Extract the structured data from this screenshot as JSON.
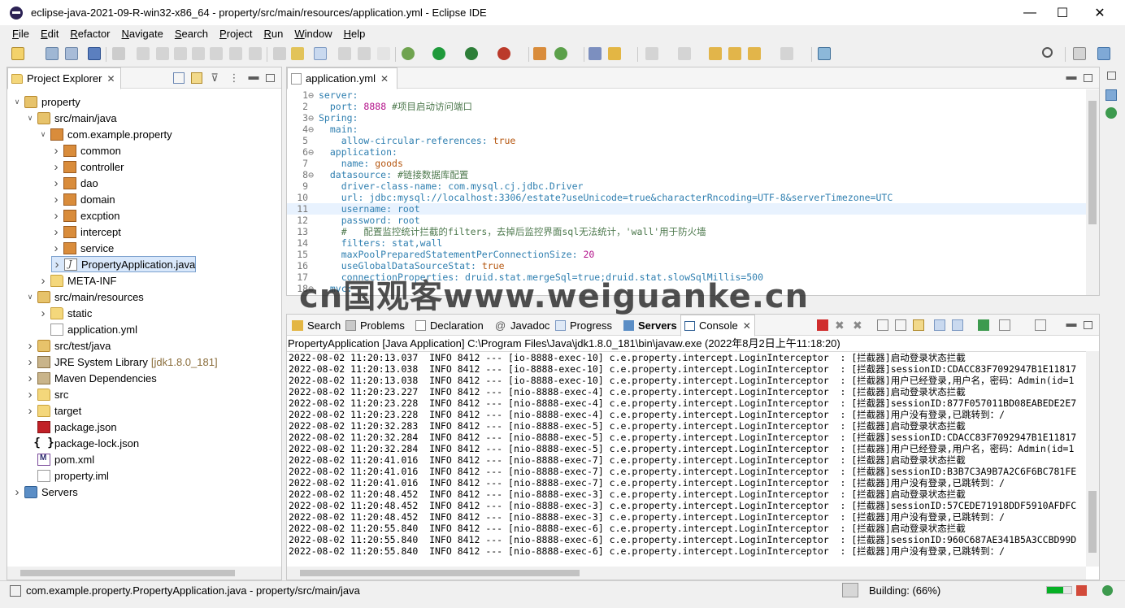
{
  "window": {
    "title": "eclipse-java-2021-09-R-win32-x86_64 - property/src/main/resources/application.yml - Eclipse IDE",
    "minimize": "—",
    "maximize": "☐",
    "close": "✕"
  },
  "menu": [
    "File",
    "Edit",
    "Refactor",
    "Navigate",
    "Search",
    "Project",
    "Run",
    "Window",
    "Help"
  ],
  "explorer": {
    "tab_label": "Project Explorer",
    "tree": [
      {
        "label": "property",
        "level": 0,
        "twisty": "v",
        "icon": "project-icon"
      },
      {
        "label": "src/main/java",
        "level": 1,
        "twisty": "v",
        "icon": "source-folder-icon"
      },
      {
        "label": "com.example.property",
        "level": 2,
        "twisty": "v",
        "icon": "package-icon"
      },
      {
        "label": "common",
        "level": 3,
        "twisty": ">",
        "icon": "package-icon"
      },
      {
        "label": "controller",
        "level": 3,
        "twisty": ">",
        "icon": "package-icon"
      },
      {
        "label": "dao",
        "level": 3,
        "twisty": ">",
        "icon": "package-icon"
      },
      {
        "label": "domain",
        "level": 3,
        "twisty": ">",
        "icon": "package-icon"
      },
      {
        "label": "excption",
        "level": 3,
        "twisty": ">",
        "icon": "package-icon"
      },
      {
        "label": "intercept",
        "level": 3,
        "twisty": ">",
        "icon": "package-icon"
      },
      {
        "label": "service",
        "level": 3,
        "twisty": ">",
        "icon": "package-icon"
      },
      {
        "label": "PropertyApplication.java",
        "level": 3,
        "twisty": ">",
        "icon": "java-file-icon",
        "selected": true
      },
      {
        "label": "META-INF",
        "level": 2,
        "twisty": ">",
        "icon": "folder-icon"
      },
      {
        "label": "src/main/resources",
        "level": 1,
        "twisty": "v",
        "icon": "source-folder-icon"
      },
      {
        "label": "static",
        "level": 2,
        "twisty": ">",
        "icon": "folder-icon"
      },
      {
        "label": "application.yml",
        "level": 2,
        "twisty": "",
        "icon": "yml-file-icon"
      },
      {
        "label": "src/test/java",
        "level": 1,
        "twisty": ">",
        "icon": "source-folder-icon"
      },
      {
        "label": "JRE System Library",
        "decor": "[jdk1.8.0_181]",
        "level": 1,
        "twisty": ">",
        "icon": "library-icon"
      },
      {
        "label": "Maven Dependencies",
        "level": 1,
        "twisty": ">",
        "icon": "library-icon"
      },
      {
        "label": "src",
        "level": 1,
        "twisty": ">",
        "icon": "folder-icon"
      },
      {
        "label": "target",
        "level": 1,
        "twisty": ">",
        "icon": "folder-icon"
      },
      {
        "label": "package.json",
        "level": 1,
        "twisty": "",
        "icon": "npm-icon"
      },
      {
        "label": "package-lock.json",
        "level": 1,
        "twisty": "",
        "icon": "json-icon"
      },
      {
        "label": "pom.xml",
        "level": 1,
        "twisty": "",
        "icon": "maven-xml-icon"
      },
      {
        "label": "property.iml",
        "level": 1,
        "twisty": "",
        "icon": "file-icon"
      },
      {
        "label": "Servers",
        "level": 0,
        "twisty": ">",
        "icon": "servers-folder-icon"
      }
    ]
  },
  "editor": {
    "tab_label": "application.yml",
    "lines": [
      {
        "n": "1",
        "fold": "⊖",
        "parts": [
          [
            "k",
            "server:"
          ]
        ]
      },
      {
        "n": "2",
        "fold": "",
        "parts": [
          [
            "p",
            "  "
          ],
          [
            "k",
            "port:"
          ],
          [
            "p",
            " "
          ],
          [
            "n",
            "8888"
          ],
          [
            "c",
            " #项目启动访问端口"
          ]
        ]
      },
      {
        "n": "3",
        "fold": "⊖",
        "parts": [
          [
            "k",
            "Spring:"
          ]
        ]
      },
      {
        "n": "4",
        "fold": "⊖",
        "parts": [
          [
            "p",
            "  "
          ],
          [
            "k",
            "main:"
          ]
        ]
      },
      {
        "n": "5",
        "fold": "",
        "parts": [
          [
            "p",
            "    "
          ],
          [
            "k",
            "allow-circular-references:"
          ],
          [
            "p",
            " "
          ],
          [
            "v",
            "true"
          ]
        ]
      },
      {
        "n": "6",
        "fold": "⊖",
        "parts": [
          [
            "p",
            "  "
          ],
          [
            "k",
            "application:"
          ]
        ]
      },
      {
        "n": "7",
        "fold": "",
        "parts": [
          [
            "p",
            "    "
          ],
          [
            "k",
            "name:"
          ],
          [
            "p",
            " "
          ],
          [
            "v",
            "goods"
          ]
        ]
      },
      {
        "n": "8",
        "fold": "⊖",
        "parts": [
          [
            "p",
            "  "
          ],
          [
            "k",
            "datasource:"
          ],
          [
            "c",
            " #链接数据库配置"
          ]
        ]
      },
      {
        "n": "9",
        "fold": "",
        "parts": [
          [
            "p",
            "    "
          ],
          [
            "k",
            "driver-class-name:"
          ],
          [
            "p",
            " "
          ],
          [
            "k",
            "com.mysql.cj.jdbc.Driver"
          ]
        ]
      },
      {
        "n": "10",
        "fold": "",
        "parts": [
          [
            "p",
            "    "
          ],
          [
            "k",
            "url:"
          ],
          [
            "p",
            " "
          ],
          [
            "k",
            "jdbc:mysql://localhost:3306/estate?useUnicode=true&characterRncoding=UTF-8&serverTimezone=UTC"
          ]
        ]
      },
      {
        "n": "11",
        "fold": "",
        "parts": [
          [
            "p",
            "    "
          ],
          [
            "k",
            "username:"
          ],
          [
            "p",
            " "
          ],
          [
            "k",
            "root"
          ]
        ]
      },
      {
        "n": "12",
        "fold": "",
        "parts": [
          [
            "p",
            "    "
          ],
          [
            "k",
            "password:"
          ],
          [
            "p",
            " "
          ],
          [
            "k",
            "root"
          ]
        ]
      },
      {
        "n": "13",
        "fold": "",
        "parts": [
          [
            "c",
            "    #   配置监控统计拦截的filters，去掉后监控界面sql无法统计，'wall'用于防火墙"
          ]
        ]
      },
      {
        "n": "14",
        "fold": "",
        "parts": [
          [
            "p",
            "    "
          ],
          [
            "k",
            "filters:"
          ],
          [
            "p",
            " "
          ],
          [
            "k",
            "stat,wall"
          ]
        ]
      },
      {
        "n": "15",
        "fold": "",
        "parts": [
          [
            "p",
            "    "
          ],
          [
            "k",
            "maxPoolPreparedStatementPerConnectionSize:"
          ],
          [
            "p",
            " "
          ],
          [
            "n",
            "20"
          ]
        ]
      },
      {
        "n": "16",
        "fold": "",
        "parts": [
          [
            "p",
            "    "
          ],
          [
            "k",
            "useGlobalDataSourceStat:"
          ],
          [
            "p",
            " "
          ],
          [
            "v",
            "true"
          ]
        ]
      },
      {
        "n": "17",
        "fold": "",
        "parts": [
          [
            "p",
            "    "
          ],
          [
            "k",
            "connectionProperties:"
          ],
          [
            "p",
            " "
          ],
          [
            "k",
            "druid.stat.mergeSql=true;druid.stat.slowSqlMillis=500"
          ]
        ]
      },
      {
        "n": "18",
        "fold": "⊖",
        "parts": [
          [
            "p",
            "  "
          ],
          [
            "k",
            "mvc:"
          ]
        ]
      }
    ]
  },
  "bottom": {
    "tabs": [
      "Search",
      "Problems",
      "Declaration",
      "Javadoc",
      "Progress",
      "Servers",
      "Console"
    ],
    "active_tab": "Console",
    "console_header": "PropertyApplication [Java Application] C:\\Program Files\\Java\\jdk1.8.0_181\\bin\\javaw.exe  (2022年8月2日上午11:18:20)",
    "log": [
      "2022-08-02 11:20:13.037  INFO 8412 --- [io-8888-exec-10] c.e.property.intercept.LoginInterceptor  : [拦截器]启动登录状态拦截",
      "2022-08-02 11:20:13.038  INFO 8412 --- [io-8888-exec-10] c.e.property.intercept.LoginInterceptor  : [拦截器]sessionID:CDACC83F7092947B1E11817",
      "2022-08-02 11:20:13.038  INFO 8412 --- [io-8888-exec-10] c.e.property.intercept.LoginInterceptor  : [拦截器]用户已经登录,用户名，密码：Admin(id=1",
      "2022-08-02 11:20:23.227  INFO 8412 --- [nio-8888-exec-4] c.e.property.intercept.LoginInterceptor  : [拦截器]启动登录状态拦截",
      "2022-08-02 11:20:23.228  INFO 8412 --- [nio-8888-exec-4] c.e.property.intercept.LoginInterceptor  : [拦截器]sessionID:877F057011BD08EABEDE2E7",
      "2022-08-02 11:20:23.228  INFO 8412 --- [nio-8888-exec-4] c.e.property.intercept.LoginInterceptor  : [拦截器]用户没有登录,已跳转到：/",
      "2022-08-02 11:20:32.283  INFO 8412 --- [nio-8888-exec-5] c.e.property.intercept.LoginInterceptor  : [拦截器]启动登录状态拦截",
      "2022-08-02 11:20:32.284  INFO 8412 --- [nio-8888-exec-5] c.e.property.intercept.LoginInterceptor  : [拦截器]sessionID:CDACC83F7092947B1E11817",
      "2022-08-02 11:20:32.284  INFO 8412 --- [nio-8888-exec-5] c.e.property.intercept.LoginInterceptor  : [拦截器]用户已经登录,用户名，密码：Admin(id=1",
      "2022-08-02 11:20:41.016  INFO 8412 --- [nio-8888-exec-7] c.e.property.intercept.LoginInterceptor  : [拦截器]启动登录状态拦截",
      "2022-08-02 11:20:41.016  INFO 8412 --- [nio-8888-exec-7] c.e.property.intercept.LoginInterceptor  : [拦截器]sessionID:B3B7C3A9B7A2C6F6BC781FE",
      "2022-08-02 11:20:41.016  INFO 8412 --- [nio-8888-exec-7] c.e.property.intercept.LoginInterceptor  : [拦截器]用户没有登录,已跳转到：/",
      "2022-08-02 11:20:48.452  INFO 8412 --- [nio-8888-exec-3] c.e.property.intercept.LoginInterceptor  : [拦截器]启动登录状态拦截",
      "2022-08-02 11:20:48.452  INFO 8412 --- [nio-8888-exec-3] c.e.property.intercept.LoginInterceptor  : [拦截器]sessionID:57CEDE71918DDF5910AFDFC",
      "2022-08-02 11:20:48.452  INFO 8412 --- [nio-8888-exec-3] c.e.property.intercept.LoginInterceptor  : [拦截器]用户没有登录,已跳转到：/",
      "2022-08-02 11:20:55.840  INFO 8412 --- [nio-8888-exec-6] c.e.property.intercept.LoginInterceptor  : [拦截器]启动登录状态拦截",
      "2022-08-02 11:20:55.840  INFO 8412 --- [nio-8888-exec-6] c.e.property.intercept.LoginInterceptor  : [拦截器]sessionID:960C687AE341B5A3CCBD99D",
      "2022-08-02 11:20:55.840  INFO 8412 --- [nio-8888-exec-6] c.e.property.intercept.LoginInterceptor  : [拦截器]用户没有登录,已跳转到：/"
    ]
  },
  "status": {
    "selection": "com.example.property.PropertyApplication.java - property/src/main/java",
    "building": "Building: (66%)",
    "build_progress": 0.66
  },
  "watermark": "cn国观客www.weiguanke.cn",
  "colors": {
    "accent": "#2f7fb0",
    "progress": "#06b025",
    "selection": "#d9e8fb"
  }
}
